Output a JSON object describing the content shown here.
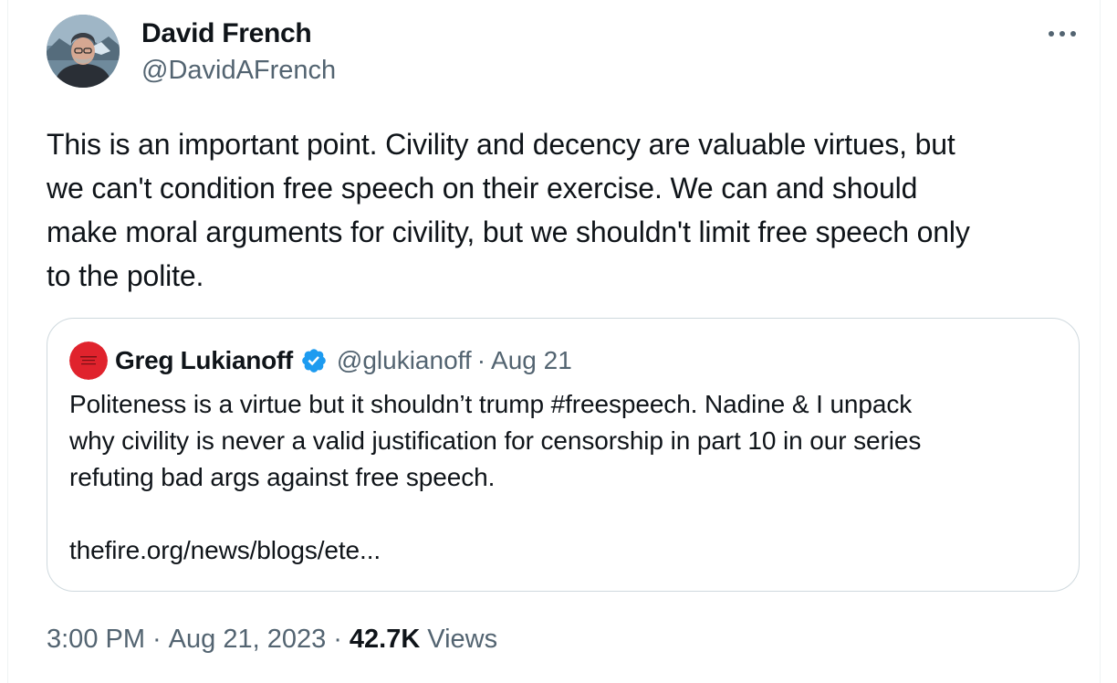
{
  "tweet": {
    "author": {
      "name": "David French",
      "handle": "@DavidAFrench",
      "avatar_icon": "profile-photo"
    },
    "more_icon": "more-options-icon",
    "text": "This is an important point. Civility and decency are valuable virtues, but\nwe can't condition free speech on their exercise. We can and should\nmake moral arguments for civility, but we shouldn't limit free speech only\nto the polite.",
    "timestamp": {
      "time": "3:00 PM",
      "separator": "·",
      "date": "Aug 21, 2023"
    },
    "views": {
      "count": "42.7K",
      "label": "Views"
    }
  },
  "quoted_tweet": {
    "author": {
      "name": "Greg Lukianoff",
      "verified": true,
      "verified_icon": "verified-badge-icon",
      "handle": "@glukianoff",
      "separator": "·",
      "date": "Aug 21",
      "avatar_icon": "red-book-avatar"
    },
    "text": "Politeness is a virtue but it shouldn’t trump #freespeech. Nadine & I unpack\nwhy civility is never a valid justification for censorship in part 10 in our series\nrefuting bad args against free speech.",
    "link": "thefire.org/news/blogs/ete..."
  },
  "colors": {
    "text_primary": "#0f1419",
    "text_secondary": "#536471",
    "border": "#cfd9de",
    "verified_blue": "#1d9bf0",
    "quote_avatar_red": "#e0232d"
  }
}
